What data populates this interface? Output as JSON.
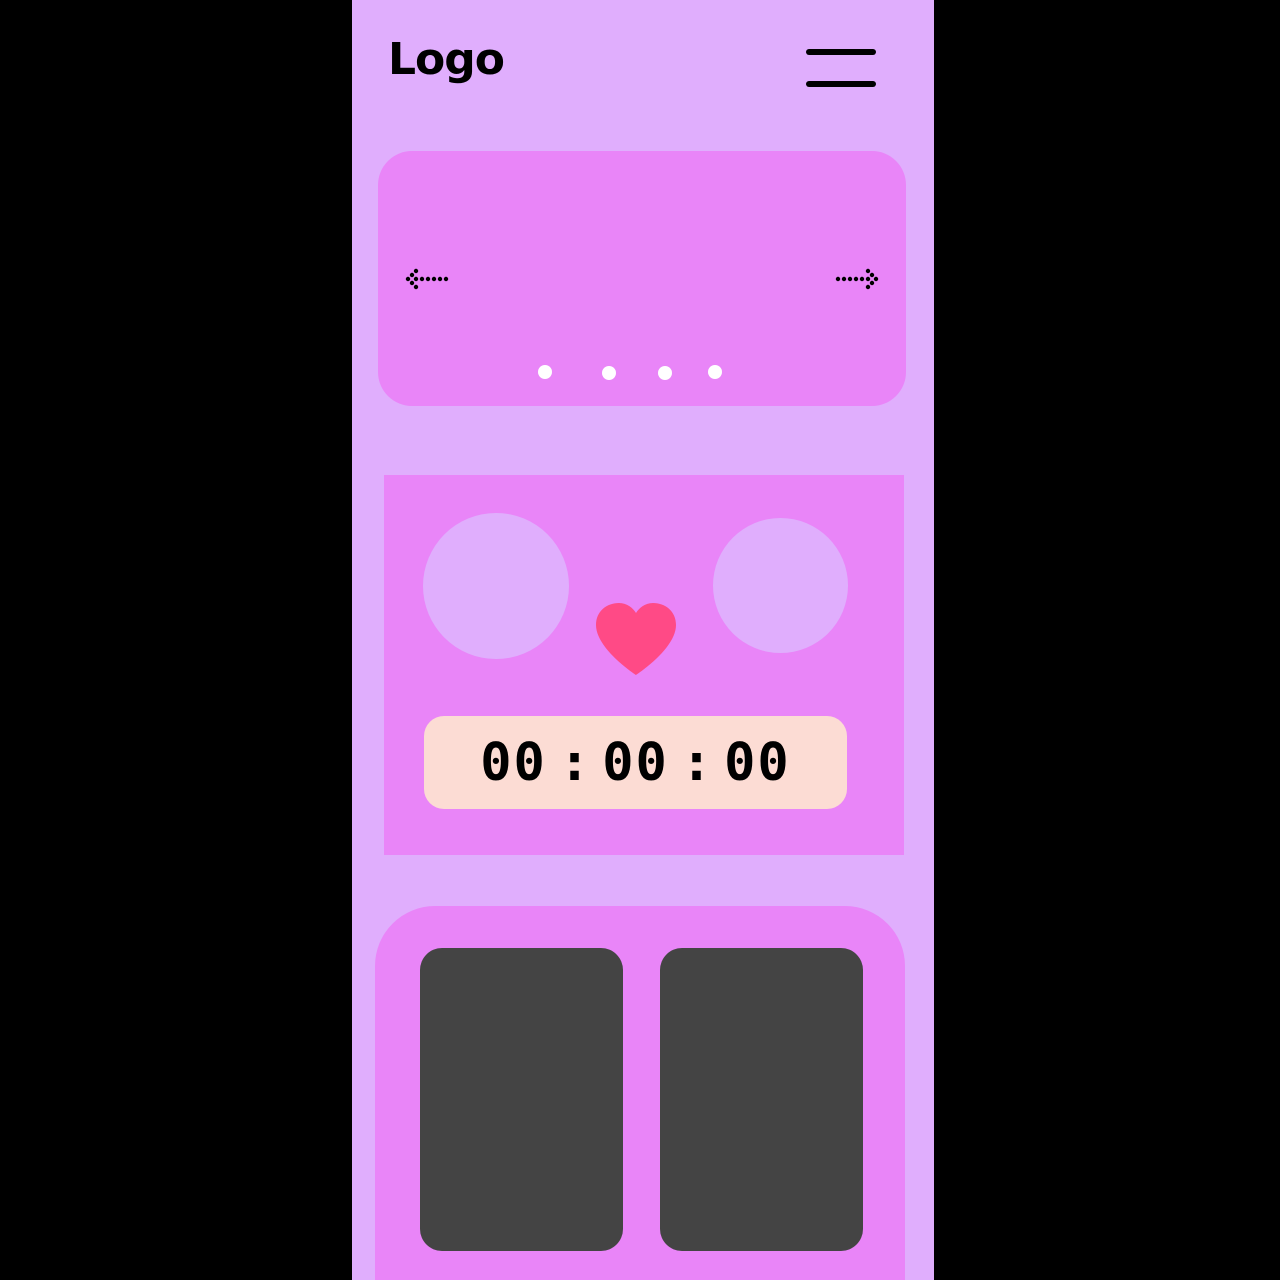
{
  "header": {
    "logo_text": "Logo",
    "menu_icon": "hamburger-menu-icon"
  },
  "carousel": {
    "prev_icon": "dotted-arrow-left-icon",
    "next_icon": "dotted-arrow-right-icon",
    "slide_count": 4
  },
  "countdown": {
    "hours": "00",
    "minutes": "00",
    "seconds": "00",
    "separator": ":",
    "heart_icon": "heart-icon"
  },
  "colors": {
    "page_bg": "#e0aefd",
    "card_bg": "#e985f8",
    "heart": "#ff4a86",
    "timer_bg": "#fcdcd4",
    "tile_bg": "#444444"
  }
}
